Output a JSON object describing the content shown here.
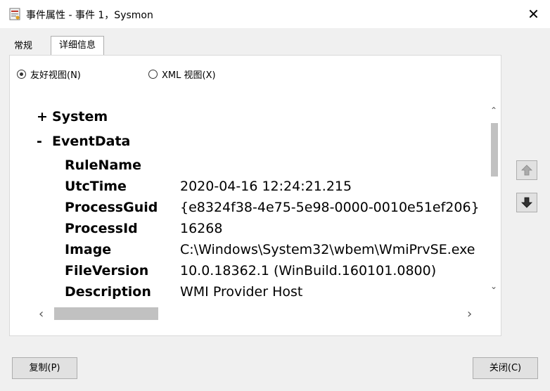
{
  "window": {
    "title": "事件属性 - 事件 1，Sysmon",
    "close_glyph": "✕"
  },
  "tabs": [
    {
      "label": "常规"
    },
    {
      "label": "详细信息"
    }
  ],
  "view_options": {
    "friendly": "友好视图(N)",
    "xml": "XML 视图(X)",
    "selected": "friendly"
  },
  "tree": {
    "system": {
      "sign": "+",
      "label": "System"
    },
    "event_data": {
      "sign": "-",
      "label": "EventData"
    },
    "fields": [
      {
        "key": "RuleName",
        "value": ""
      },
      {
        "key": "UtcTime",
        "value": "2020-04-16 12:24:21.215"
      },
      {
        "key": "ProcessGuid",
        "value": "{e8324f38-4e75-5e98-0000-0010e51ef206}"
      },
      {
        "key": "ProcessId",
        "value": "16268"
      },
      {
        "key": "Image",
        "value": "C:\\Windows\\System32\\wbem\\WmiPrvSE.exe"
      },
      {
        "key": "FileVersion",
        "value": "10.0.18362.1 (WinBuild.160101.0800)"
      },
      {
        "key": "Description",
        "value": "WMI Provider Host"
      }
    ]
  },
  "buttons": {
    "copy": "复制(P)",
    "close": "关闭(C)"
  },
  "icons": {
    "app": "event-viewer-icon",
    "up": "arrow-up-icon",
    "down": "arrow-down-icon"
  }
}
